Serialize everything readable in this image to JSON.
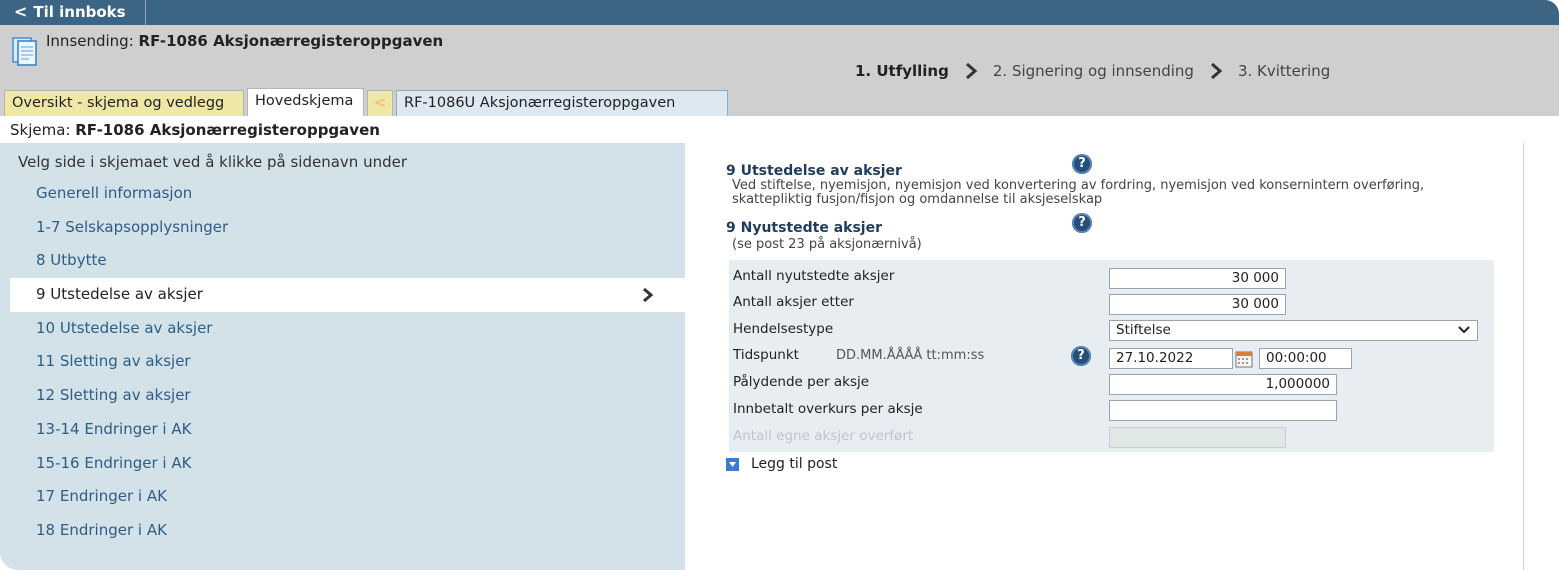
{
  "topbar": {
    "back_label": "Til innboks"
  },
  "header": {
    "submission_prefix": "Innsending:",
    "submission_title": "RF-1086 Aksjonærregisteroppgaven",
    "steps": [
      {
        "label": "1. Utfylling"
      },
      {
        "label": "2. Signering og innsending"
      },
      {
        "label": "3. Kvittering"
      }
    ],
    "tabs": {
      "overview": "Oversikt - skjema og vedlegg",
      "main": "Hovedskjema",
      "back": "<",
      "sub": "RF-1086U Aksjonærregisteroppgaven"
    }
  },
  "schema": {
    "prefix": "Skjema:",
    "title": "RF-1086 Aksjonærregisteroppgaven"
  },
  "nav": {
    "intro": "Velg side i skjemaet ved å klikke på sidenavn under",
    "items": [
      {
        "label": "Generell informasjon"
      },
      {
        "label": "1-7 Selskapsopplysninger"
      },
      {
        "label": "8 Utbytte"
      },
      {
        "label": "9 Utstedelse av aksjer"
      },
      {
        "label": "10 Utstedelse av aksjer"
      },
      {
        "label": "11 Sletting av aksjer"
      },
      {
        "label": "12 Sletting av aksjer"
      },
      {
        "label": "13-14 Endringer i AK"
      },
      {
        "label": "15-16 Endringer i AK"
      },
      {
        "label": "17 Endringer i AK"
      },
      {
        "label": "18 Endringer i AK"
      }
    ],
    "active_index": 3
  },
  "content": {
    "section1": {
      "title": "9 Utstedelse av aksjer",
      "desc_line1": "Ved stiftelse, nyemisjon, nyemisjon ved konvertering av fordring, nyemisjon ved konsernintern overføring,",
      "desc_line2": "skattepliktig fusjon/fisjon og omdannelse til aksjeselskap"
    },
    "section2": {
      "title": "9 Nyutstedte aksjer",
      "subtitle": "(se post 23 på aksjonærnivå)"
    },
    "fields": {
      "new_shares_label": "Antall nyutstedte aksjer",
      "new_shares_value": "30 000",
      "shares_after_label": "Antall aksjer etter",
      "shares_after_value": "30 000",
      "event_type_label": "Hendelsestype",
      "event_type_value": "Stiftelse",
      "timestamp_label": "Tidspunkt",
      "timestamp_hint": "DD.MM.ÅÅÅÅ tt:mm:ss",
      "date_value": "27.10.2022",
      "time_value": "00:00:00",
      "par_value_label": "Pålydende per aksje",
      "par_value_value": "1,000000",
      "premium_label": "Innbetalt overkurs per aksje",
      "premium_value": "",
      "own_shares_label": "Antall egne aksjer overført",
      "own_shares_value": ""
    },
    "add_post_label": "Legg til post",
    "help_symbol": "?"
  },
  "colors": {
    "topbar": "#3c6485",
    "header_bg": "#cfcfcf",
    "nav_bg": "#d3e1e9",
    "nav_link": "#2e5d86",
    "form_bg": "#e8edf1",
    "help_icon": "#244f7d"
  }
}
